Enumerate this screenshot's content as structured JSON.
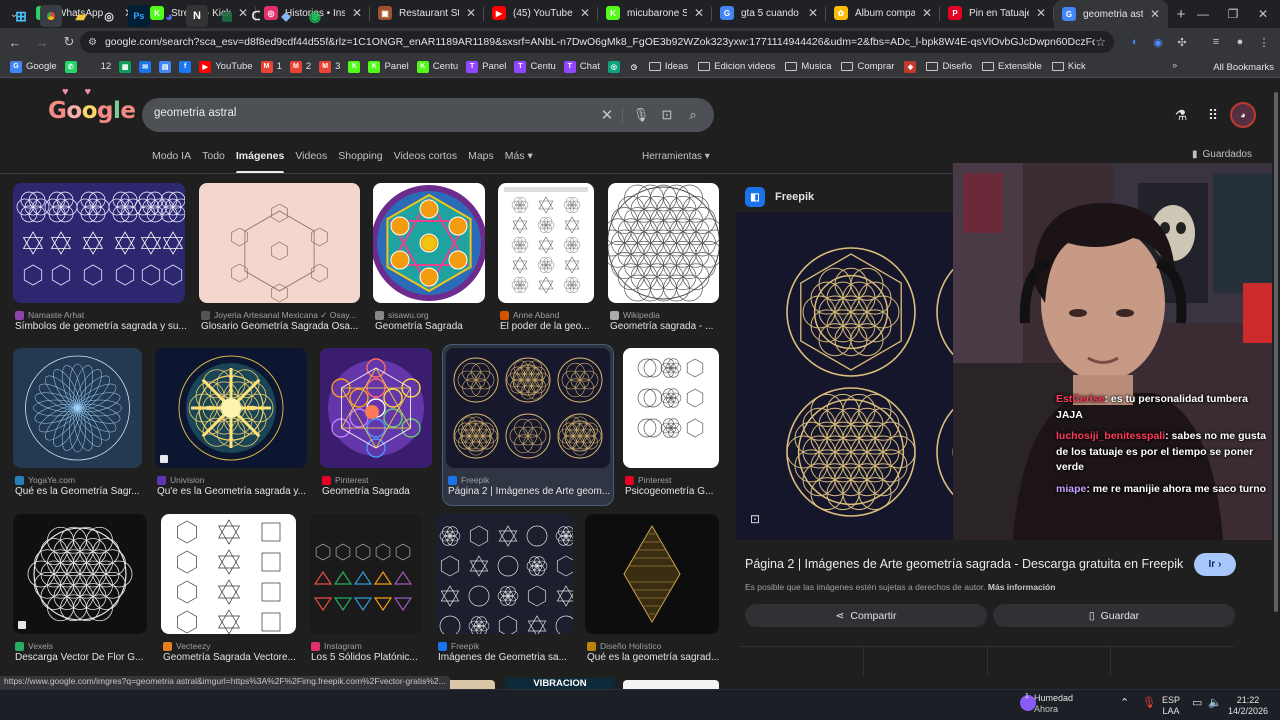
{
  "browser": {
    "tabs": [
      {
        "title": "WhatsApp",
        "color": "#25d366",
        "glyph": "✆"
      },
      {
        "title": "Stream - Kick Dashboard",
        "color": "#53fc18",
        "glyph": "K"
      },
      {
        "title": "Historias • Instagram",
        "color": "#e1306c",
        "glyph": "◎"
      },
      {
        "title": "Restaurant Stories",
        "color": "#a0522d",
        "glyph": "▣"
      },
      {
        "title": "(45) YouTube",
        "color": "#ff0000",
        "glyph": "▶"
      },
      {
        "title": "micubarone Stream",
        "color": "#53fc18",
        "glyph": "K"
      },
      {
        "title": "gta 5 cuando slams",
        "color": "#4285f4",
        "glyph": "G"
      },
      {
        "title": "Álbum compartido",
        "color": "#fbbc04",
        "glyph": "✿"
      },
      {
        "title": "Pin en Tatuajes",
        "color": "#e60023",
        "glyph": "P"
      },
      {
        "title": "geometria astral",
        "color": "#4285f4",
        "glyph": "G"
      }
    ],
    "url": "google.com/search?sca_esv=d8f8ed9cdf44d55f&rlz=1C1ONGR_enAR1189AR1189&sxsrf=ANbL-n7DwO6gMk8_FgOE3b92WZok323yxw:1771114944426&udm=2&fbs=ADc_l-bpk8W4E-qsVlOvbGJcDwpn60DczFdcvPnuv8WQohHLTaMb_W...",
    "bookmarks": [
      {
        "label": "Google",
        "color": "#4285f4",
        "glyph": "G"
      },
      {
        "label": "",
        "color": "#25d366",
        "glyph": "✆"
      },
      {
        "label": "12",
        "color": "#35363a",
        "glyph": ""
      },
      {
        "label": "",
        "color": "#0f9d58",
        "glyph": "▦"
      },
      {
        "label": "",
        "color": "#1a73e8",
        "glyph": "✉"
      },
      {
        "label": "",
        "color": "#4285f4",
        "glyph": "▤"
      },
      {
        "label": "",
        "color": "#1877f2",
        "glyph": "f"
      },
      {
        "label": "YouTube",
        "color": "#ff0000",
        "glyph": "▶"
      },
      {
        "label": "1",
        "color": "#ea4335",
        "glyph": "M"
      },
      {
        "label": "2",
        "color": "#ea4335",
        "glyph": "M"
      },
      {
        "label": "3",
        "color": "#ea4335",
        "glyph": "M"
      },
      {
        "label": "",
        "color": "#53fc18",
        "glyph": "K"
      },
      {
        "label": "Panel",
        "color": "#53fc18",
        "glyph": "K"
      },
      {
        "label": "Centu",
        "color": "#53fc18",
        "glyph": "K"
      },
      {
        "label": "Panel",
        "color": "#9146ff",
        "glyph": "T"
      },
      {
        "label": "Centu",
        "color": "#9146ff",
        "glyph": "T"
      },
      {
        "label": "Chat",
        "color": "#9146ff",
        "glyph": "T"
      },
      {
        "label": "",
        "color": "#10a37f",
        "glyph": "◎"
      },
      {
        "label": "",
        "color": "#35363a",
        "glyph": "◷"
      }
    ],
    "folders": [
      "Ideas",
      "Edicion videos",
      "Musica",
      "Comprar",
      "",
      "Diseño",
      "Extensible",
      "Kick"
    ],
    "all_bookmarks": "All Bookmarks"
  },
  "google": {
    "query": "geometria astral",
    "nav": [
      "Modo IA",
      "Todo",
      "Imágenes",
      "Videos",
      "Shopping",
      "Videos cortos",
      "Maps",
      "Más ▾"
    ],
    "tools": "Herramientas ▾",
    "saved": "Guardados"
  },
  "results": [
    {
      "source": "Namaste Arhat",
      "title": "Símbolos de geometría sagrada y su...",
      "sc": "#8e44ad",
      "art": "cosmic"
    },
    {
      "source": "Joyeria Artesanal Mexicana ✓ Osay...",
      "title": "Glosario Geometría Sagrada Osa...",
      "sc": "#555",
      "art": "pink"
    },
    {
      "source": "sisawu.org",
      "title": "Geometría Sagrada",
      "sc": "#888",
      "art": "metatron-color"
    },
    {
      "source": "Anne Aband",
      "title": "El poder de la geo...",
      "sc": "#d35400",
      "art": "chart"
    },
    {
      "source": "Wikipedia",
      "title": "Geometría sagrada - ...",
      "sc": "#aaa",
      "art": "flower-white"
    },
    {
      "source": "YogaYe.com",
      "title": "Qué es la Geometría Sagr...",
      "sc": "#2980b9",
      "art": "mandala-blue"
    },
    {
      "source": "Univision",
      "title": "Qu'e es la Geometría sagrada y...",
      "sc": "#5e35b1",
      "art": "gold-star"
    },
    {
      "source": "Pinterest",
      "title": "Geometría Sagrada",
      "sc": "#e60023",
      "art": "metatron-violet"
    },
    {
      "source": "Freepik",
      "title": "Página 2 | Imágenes de Arte geom...",
      "sc": "#1a73e8",
      "art": "gold-grid"
    },
    {
      "source": "Pinterest",
      "title": "Psicogeometría G...",
      "sc": "#e60023",
      "art": "line-sheet"
    },
    {
      "source": "Vexels",
      "title": "Descarga Vector De Flor G...",
      "sc": "#27ae60",
      "art": "flower-dark"
    },
    {
      "source": "Vecteezy",
      "title": "Geometría Sagrada Vectore...",
      "sc": "#e67e22",
      "art": "platonic-white"
    },
    {
      "source": "Instagram",
      "title": "Los 5 Sólidos Platónic...",
      "sc": "#e1306c",
      "art": "solids"
    },
    {
      "source": "Freepik",
      "title": "Imágenes de Geometria sa...",
      "sc": "#1a73e8",
      "art": "white-grid"
    },
    {
      "source": "Diseño Holístico",
      "title": "Qué es la geometría sagrad...",
      "sc": "#b8860b",
      "art": "diamond"
    }
  ],
  "preview": {
    "source": "Freepik",
    "title": "Página 2 | Imágenes de Arte geometría sagrada - Descarga gratuita en Freepik",
    "go_label": "Ir",
    "notice": "Es posible que las imágenes estén sujetas a derechos de autor.",
    "more_info": "Más información",
    "share_label": "Compartir",
    "save_label": "Guardar"
  },
  "chat": [
    {
      "user": "EstCerise",
      "text": ": es tu personalidad tumbera JAJA",
      "color": "#ff3b5c"
    },
    {
      "user": "luchosiji_benitesspali",
      "text": ": sabes no me gusta de los tatuaje es por el tiempo se poner verde",
      "color": "#ff3b5c"
    },
    {
      "user": "miape",
      "text": ": me re manijie ahora me saco turno",
      "color": "#c9a0ff"
    }
  ],
  "status_url": "https://www.google.com/imgres?q=geometria astral&imgurl=https%3A%2F%2Fimg.freepik.com%2Fvector-gratis%2...",
  "partial_row_text": "VIBRACION",
  "taskbar": {
    "weather_temp": "1",
    "weather_label": "Humedad",
    "weather_sub": "Ahora",
    "lang": "ESP",
    "lang_sub": "LAA",
    "time": "21:22",
    "date": "14/2/2026"
  }
}
